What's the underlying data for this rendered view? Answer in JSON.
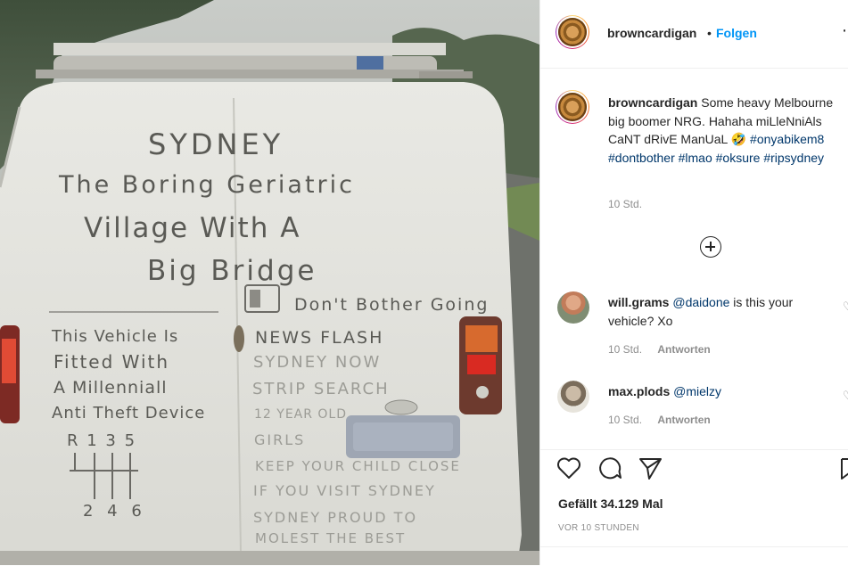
{
  "post_image": {
    "van_writing": {
      "top": [
        "SYDNEY",
        "The Boring Geriatric",
        "Village   With A",
        "Big   Bridge"
      ],
      "left_panel": [
        "This Vehicle Is",
        "Fitted With",
        "A Millenniall",
        "Anti Theft Device",
        "R 1 3 5",
        "2 4 6"
      ],
      "right_panel": [
        "Don't Bother Going",
        "NEWS FLASH",
        "SYDNEY NOW",
        "STRIP SEARCH",
        "12 YEAR OLD",
        "GIRLS",
        "KEEP YOUR CHILD CLOSE",
        "IF YOU VISIT SYDNEY",
        "SYDNEY PROUD TO",
        "MOLEST THE BEST"
      ]
    }
  },
  "header": {
    "username": "browncardigan",
    "separator": "•",
    "follow_label": "Folgen",
    "more_icon": "ellipsis-icon"
  },
  "caption": {
    "username": "browncardigan",
    "text": "Some heavy Melbourne big boomer NRG. Hahaha miLleNniAls CaNT dRivE ManUaL 🤣",
    "hashtags": "#onyabikem8 #dontbother #lmao #oksure #ripsydney",
    "time": "10 Std."
  },
  "load_more_icon": "plus-circle-icon",
  "comments": [
    {
      "username": "will.grams",
      "mention": "@daidone",
      "text": "is this your vehicle? Xo",
      "time": "10 Std.",
      "reply_label": "Antworten"
    },
    {
      "username": "max.plods",
      "mention": "@mielzy",
      "text": "",
      "time": "10 Std.",
      "reply_label": "Antworten"
    }
  ],
  "actions": {
    "like_icon": "heart-icon",
    "comment_icon": "comment-icon",
    "share_icon": "paper-plane-icon",
    "save_icon": "bookmark-icon",
    "likes": "Gefällt 34.129 Mal",
    "posted": "VOR 10 STUNDEN"
  },
  "colors": {
    "link": "#0095f6",
    "hashtag": "#00376b",
    "muted": "#8e8e8e"
  }
}
